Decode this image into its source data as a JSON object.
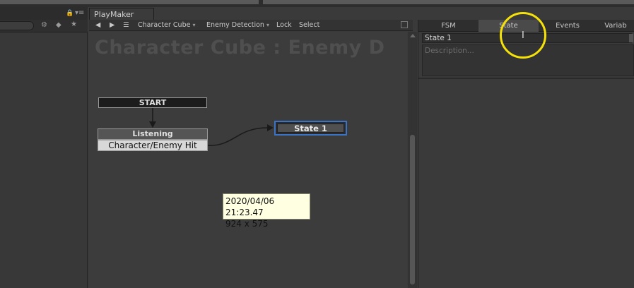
{
  "playmaker": {
    "tab_label": "PlayMaker",
    "toolbar": {
      "back_icon": "◀",
      "forward_icon": "▶",
      "menu_icon": "☰",
      "gameobject": "Character Cube",
      "fsm": "Enemy Detection",
      "lock": "Lock",
      "select": "Select"
    },
    "graph": {
      "title": "Character Cube : Enemy D",
      "start_label": "START",
      "listening_label": "Listening",
      "listening_transition": "Character/Enemy Hit",
      "state1_label": "State 1"
    },
    "tooltip": {
      "line1": "2020/04/06 21:23.47",
      "line2": "924 x 575"
    }
  },
  "inspector": {
    "tabs": [
      "FSM",
      "State",
      "Events",
      "Variab"
    ],
    "active_tab": "State",
    "state_name": "State 1",
    "description_placeholder": "Description..."
  },
  "colors": {
    "selection_border": "#3b74c4",
    "highlight": "#f5e10a",
    "tooltip_bg": "#ffffe1"
  }
}
